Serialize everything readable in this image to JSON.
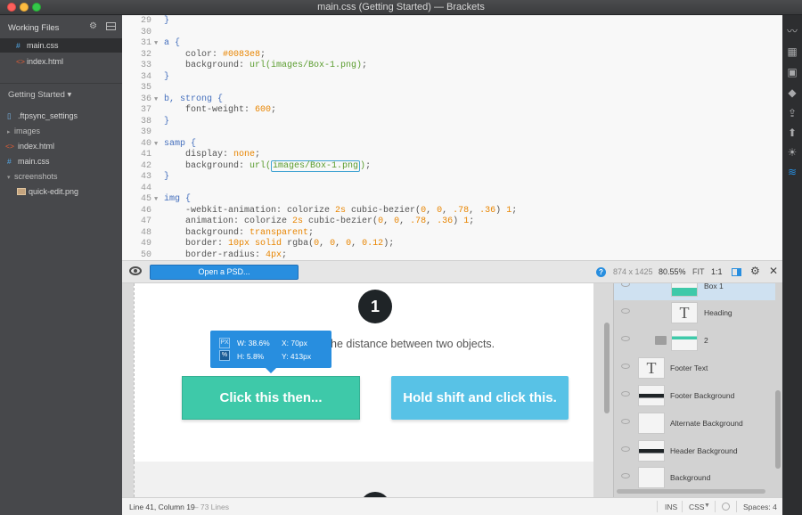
{
  "window": {
    "title": "main.css (Getting Started) — Brackets"
  },
  "sidebar": {
    "working_files_title": "Working Files",
    "working_files": [
      {
        "icon": "#",
        "name": "main.css"
      },
      {
        "icon": "<>",
        "name": "index.html"
      }
    ],
    "project_title": "Getting Started ▾",
    "tree": [
      {
        "type": "file",
        "icon": "▯",
        "name": ".ftpsync_settings"
      },
      {
        "type": "folder",
        "icon": "▸",
        "name": "images"
      },
      {
        "type": "file",
        "icon": "<>",
        "name": "index.html"
      },
      {
        "type": "file",
        "icon": "#",
        "name": "main.css"
      },
      {
        "type": "folder",
        "icon": "▾",
        "name": "screenshots"
      },
      {
        "type": "image",
        "icon": "img",
        "name": "quick-edit.png"
      }
    ]
  },
  "editor": {
    "lines": [
      {
        "n": "29",
        "text": "}"
      },
      {
        "n": "30",
        "text": ""
      },
      {
        "n": "31",
        "text": "a {"
      },
      {
        "n": "32",
        "text": "    color: #0083e8;"
      },
      {
        "n": "33",
        "text": "    background: url(images/Box-1.png);"
      },
      {
        "n": "34",
        "text": "}"
      },
      {
        "n": "35",
        "text": ""
      },
      {
        "n": "36",
        "text": "b, strong {"
      },
      {
        "n": "37",
        "text": "    font-weight: 600;"
      },
      {
        "n": "38",
        "text": "}"
      },
      {
        "n": "39",
        "text": ""
      },
      {
        "n": "40",
        "text": "samp {"
      },
      {
        "n": "41",
        "text": "    display: none;"
      },
      {
        "n": "42",
        "text": "    background: url(images/Box-1.png);"
      },
      {
        "n": "43",
        "text": "}"
      },
      {
        "n": "44",
        "text": ""
      },
      {
        "n": "45",
        "text": "img {"
      },
      {
        "n": "46",
        "text": "    -webkit-animation: colorize 2s cubic-bezier(0, 0, .78, .36) 1;"
      },
      {
        "n": "47",
        "text": "    animation: colorize 2s cubic-bezier(0, 0, .78, .36) 1;"
      },
      {
        "n": "48",
        "text": "    background: transparent;"
      },
      {
        "n": "49",
        "text": "    border: 10px solid rgba(0, 0, 0, 0.12);"
      },
      {
        "n": "50",
        "text": "    border-radius: 4px;"
      }
    ]
  },
  "extract_panel": {
    "open_psd_label": "Open a PSD...",
    "help_label": "?",
    "dimensions": "874 x 1425",
    "zoom": "80.55%",
    "fit_label": "FIT",
    "one_to_one_label": "1:1",
    "canvas": {
      "step_number": "1",
      "instruction": "he distance between two objects.",
      "button_primary": "Click this then...",
      "button_secondary": "Hold shift and click this.",
      "measure": {
        "px_label": "PX",
        "pct_label": "%",
        "width": "W: 38.6%",
        "height": "H: 5.8%",
        "x": "X: 70px",
        "y": "Y: 413px"
      }
    },
    "layers": [
      {
        "name": "Box 1"
      },
      {
        "name": "Heading"
      },
      {
        "name": "2"
      },
      {
        "name": "Footer Text"
      },
      {
        "name": "Footer Background"
      },
      {
        "name": "Alternate Background"
      },
      {
        "name": "Header Background"
      },
      {
        "name": "Background"
      }
    ],
    "colors": {
      "accent": "#288edf",
      "teal_button": "#3ec9a9",
      "blue_button": "#58c2e6"
    }
  },
  "statusbar": {
    "cursor": "Line 41, Column 19",
    "line_count": "— 73 Lines",
    "mode": "INS",
    "language": "CSS",
    "spaces": "Spaces: 4"
  }
}
